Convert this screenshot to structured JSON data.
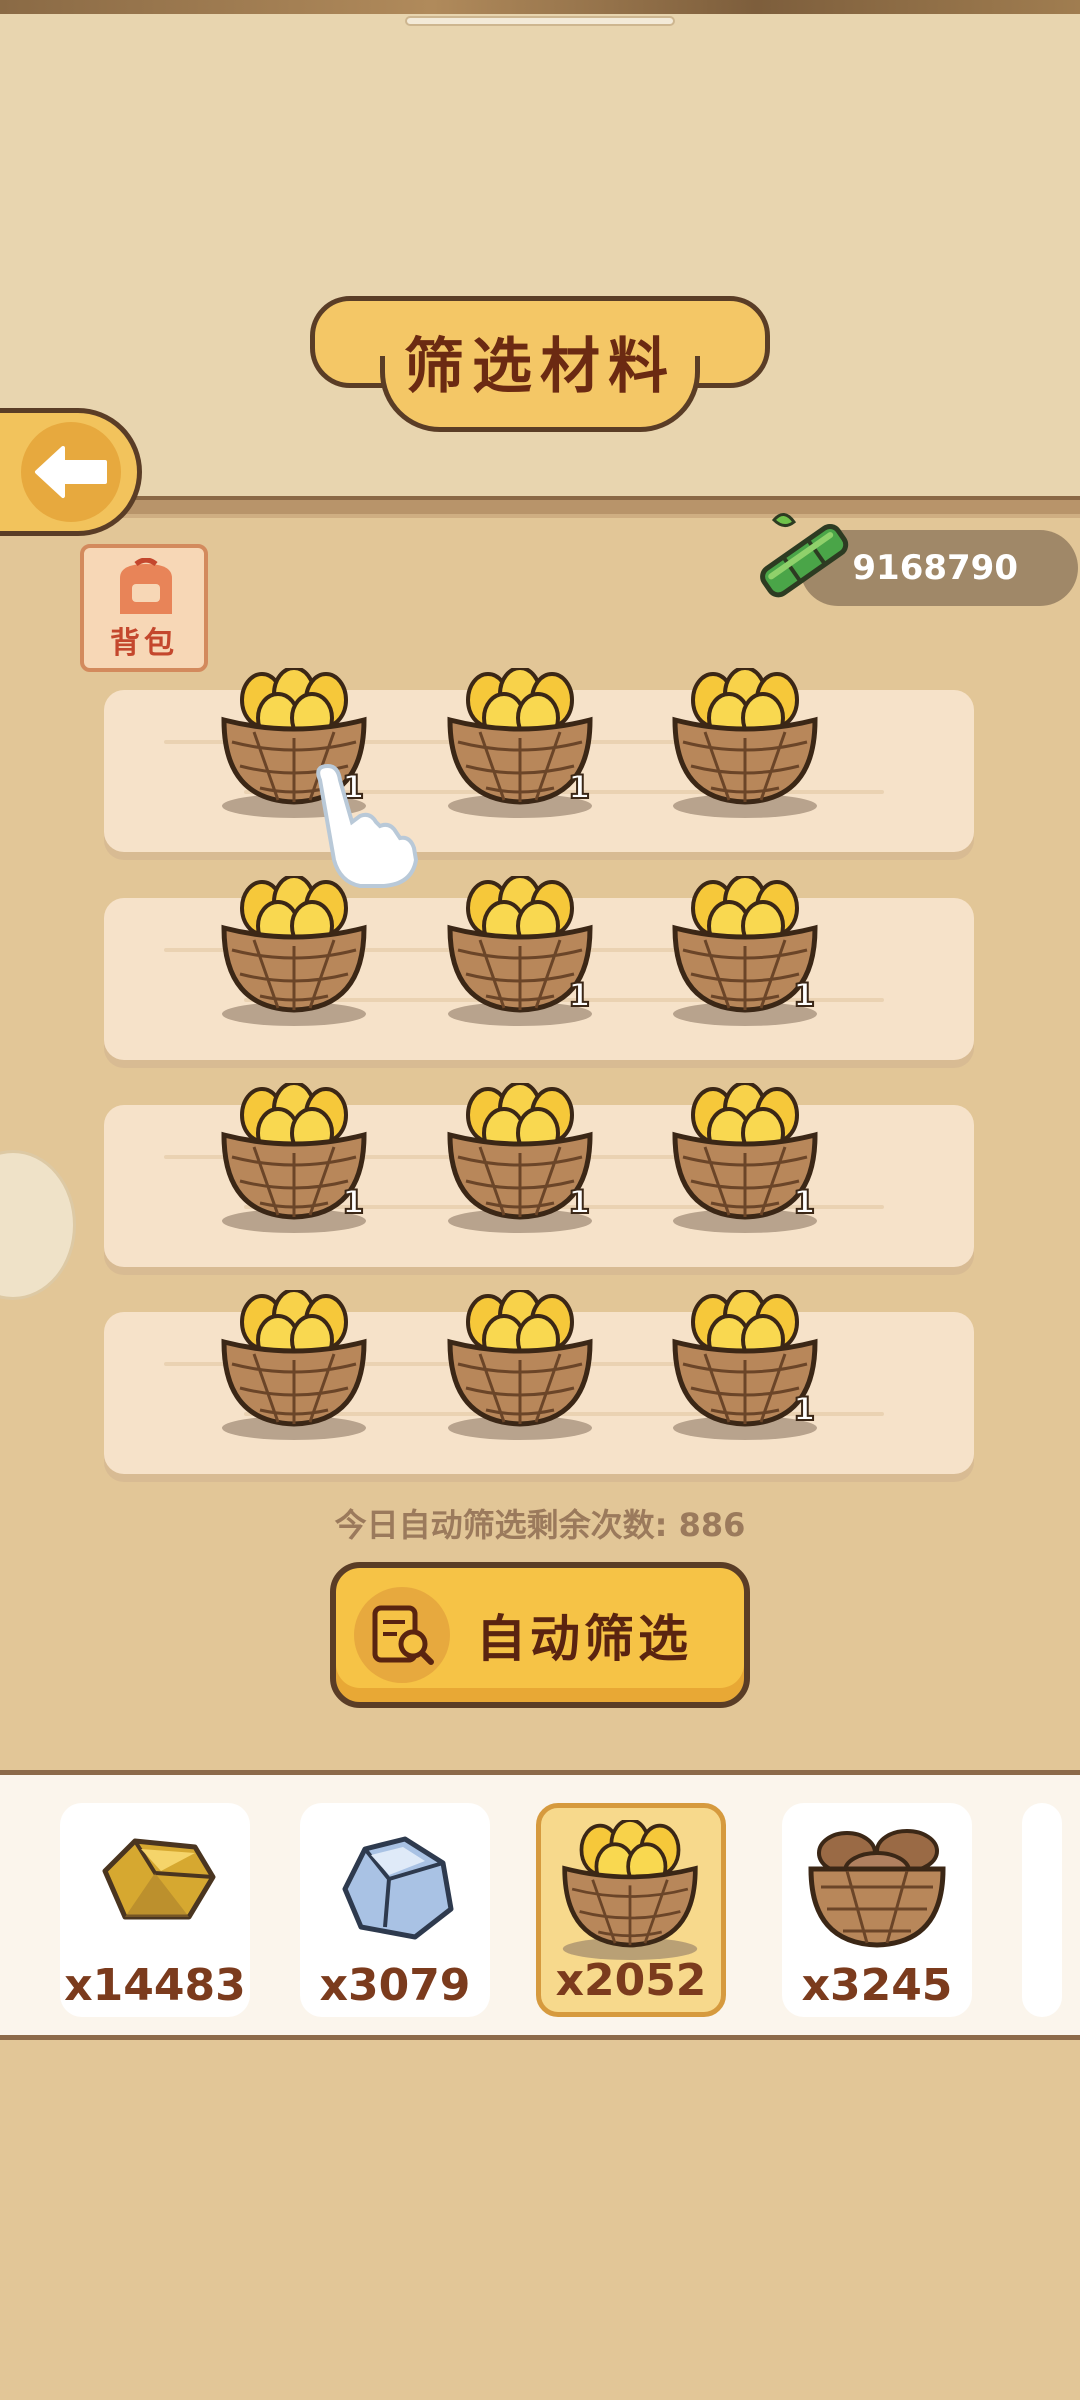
{
  "title": "筛选材料",
  "backpack_label": "背包",
  "currency": {
    "value": "9168790",
    "icon": "bamboo-icon"
  },
  "shelves": [
    {
      "baskets": [
        {
          "count": "1"
        },
        {
          "count": "1"
        },
        {
          "count": ""
        }
      ]
    },
    {
      "baskets": [
        {
          "count": ""
        },
        {
          "count": "1"
        },
        {
          "count": "1"
        }
      ]
    },
    {
      "baskets": [
        {
          "count": "1"
        },
        {
          "count": "1"
        },
        {
          "count": "1"
        }
      ]
    },
    {
      "baskets": [
        {
          "count": ""
        },
        {
          "count": ""
        },
        {
          "count": "1"
        }
      ]
    }
  ],
  "hint": "今日自动筛选剩余次数: 886",
  "auto_button_label": "自动筛选",
  "inventory": [
    {
      "name": "gold-ore",
      "qty": "x14483"
    },
    {
      "name": "silver-ore",
      "qty": "x3079"
    },
    {
      "name": "mango-basket",
      "qty": "x2052",
      "selected": true
    },
    {
      "name": "mushroom-basket",
      "qty": "x3245"
    }
  ],
  "colors": {
    "background": "#e2c697",
    "accent": "#f6c346",
    "title_text": "#6b2a12",
    "quantity_text": "#7b3b1d"
  }
}
